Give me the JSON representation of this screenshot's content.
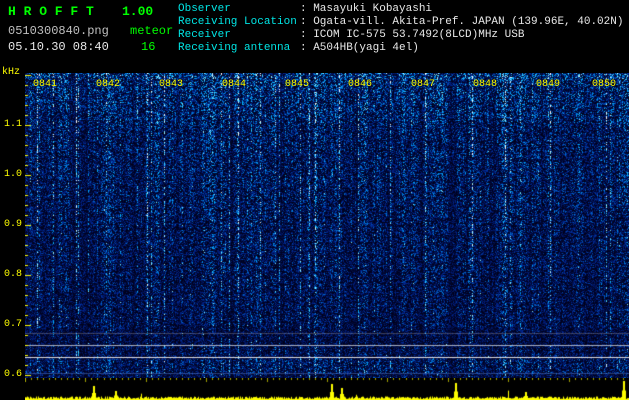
{
  "app": {
    "title": "H R O F F T",
    "version": "1.00"
  },
  "file": {
    "name": "0510300840.png",
    "mode": "meteor",
    "datetime": "05.10.30 08:40",
    "count": "16"
  },
  "info": {
    "rows": [
      {
        "label": "Observer",
        "value": ": Masayuki Kobayashi"
      },
      {
        "label": "Receiving Location",
        "value": ": Ogata-vill. Akita-Pref. JAPAN (139.96E, 40.02N)"
      },
      {
        "label": "Receiver",
        "value": ": ICOM IC-575 53.7492(8LCD)MHz USB"
      },
      {
        "label": "Receiving antenna",
        "value": ": A504HB(yagi 4el)"
      }
    ]
  },
  "spectrogram": {
    "unit": "kHz",
    "time_labels": [
      "0841",
      "0842",
      "0843",
      "0844",
      "0845",
      "0846",
      "0847",
      "0848",
      "0849",
      "0850"
    ],
    "freq_labels": [
      "1.1",
      "1.0",
      "0.9",
      "0.8",
      "0.7",
      "0.6"
    ],
    "colors": {
      "title_green": "#00ff00",
      "label_cyan": "#00e5e5",
      "value_white": "#e8e8e8",
      "axis_yellow": "#ffff00",
      "noise_blue": "#0030c0",
      "bright_cyan": "#8cf0ff",
      "carrier_line": "#e0e0e0",
      "background": "#000000"
    }
  }
}
